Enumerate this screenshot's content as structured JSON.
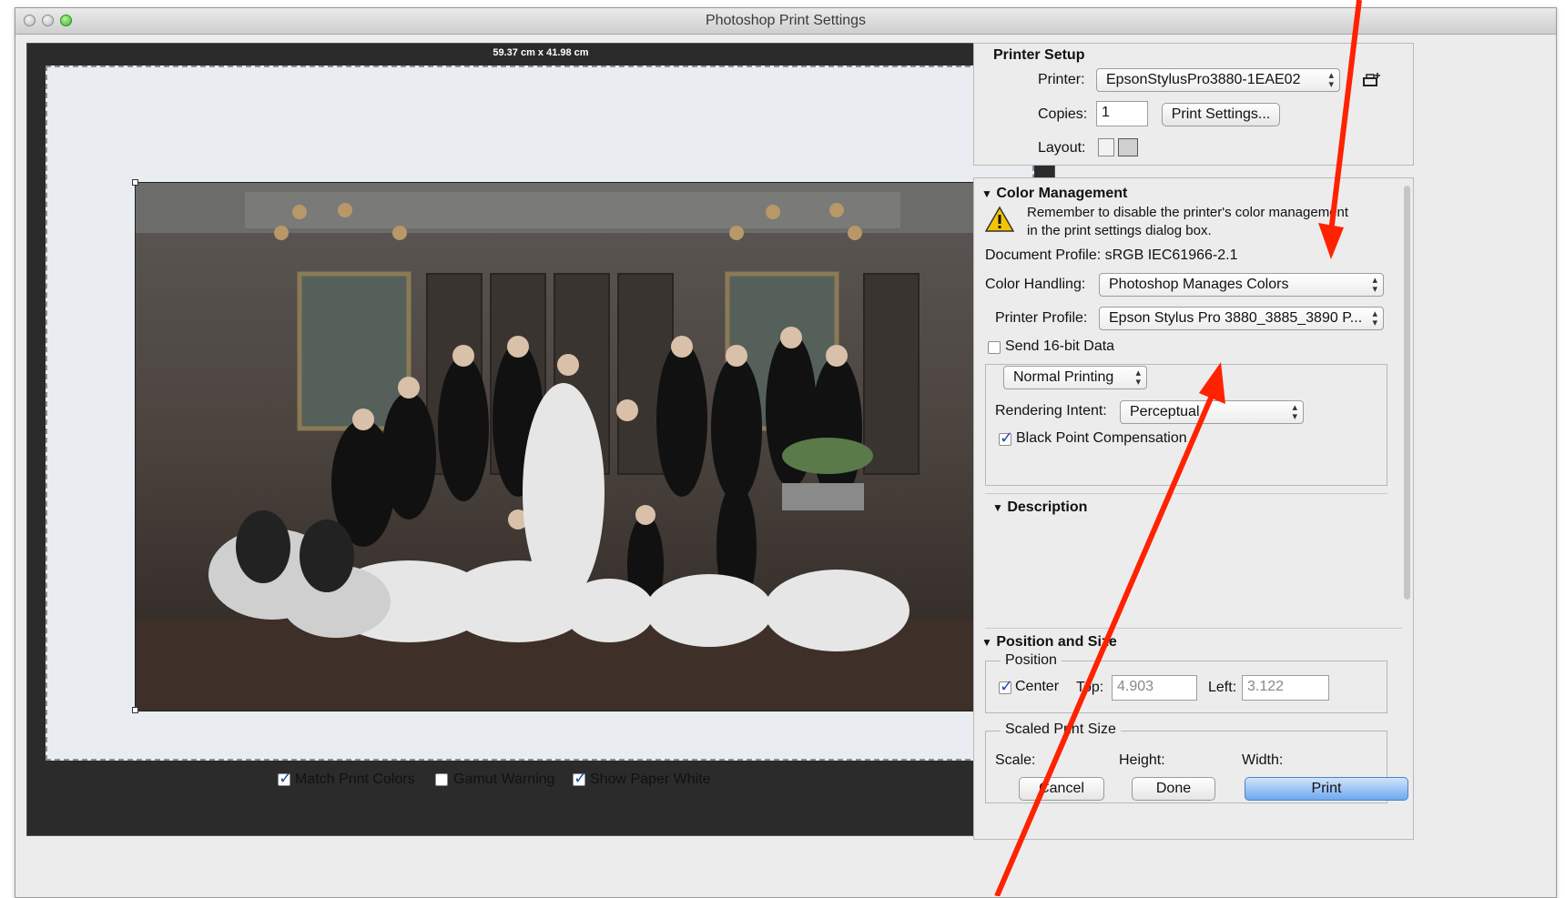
{
  "window": {
    "title": "Photoshop Print Settings"
  },
  "preview": {
    "dimensions": "59.37 cm x 41.98 cm",
    "options": [
      {
        "label": "Match Print Colors",
        "checked": true
      },
      {
        "label": "Gamut Warning",
        "checked": false
      },
      {
        "label": "Show Paper White",
        "checked": true
      }
    ]
  },
  "printer_setup": {
    "heading": "Printer Setup",
    "printer_label": "Printer:",
    "printer_value": "EpsonStylusPro3880-1EAE02",
    "copies_label": "Copies:",
    "copies_value": "1",
    "print_settings_button": "Print Settings...",
    "layout_label": "Layout:"
  },
  "color_management": {
    "heading": "Color Management",
    "warning": "Remember to disable the printer's color management in the print settings dialog box.",
    "document_profile": "Document Profile: sRGB IEC61966-2.1",
    "color_handling_label": "Color Handling:",
    "color_handling_value": "Photoshop Manages Colors",
    "printer_profile_label": "Printer Profile:",
    "printer_profile_value": "Epson Stylus Pro 3880_3885_3890 P...",
    "send16_label": "Send 16-bit Data",
    "send16_checked": false,
    "normal_printing_value": "Normal Printing",
    "rendering_intent_label": "Rendering Intent:",
    "rendering_intent_value": "Perceptual",
    "bpc_label": "Black Point Compensation",
    "bpc_checked": true
  },
  "description": {
    "heading": "Description"
  },
  "position_size": {
    "heading": "Position and Size",
    "position_group": "Position",
    "center_label": "Center",
    "center_checked": true,
    "top_label": "Top:",
    "top_value": "4.903",
    "left_label": "Left:",
    "left_value": "3.122",
    "scaled_group": "Scaled Print Size",
    "scale_label": "Scale:",
    "height_label": "Height:",
    "width_label": "Width:"
  },
  "buttons": {
    "cancel": "Cancel",
    "done": "Done",
    "print": "Print"
  },
  "colors": {
    "annotation_arrow": "#ff2200",
    "print_button": "#6fa8ee"
  },
  "icons": [
    "warning-icon",
    "printer-add-icon",
    "portrait-layout-icon",
    "landscape-layout-icon"
  ]
}
